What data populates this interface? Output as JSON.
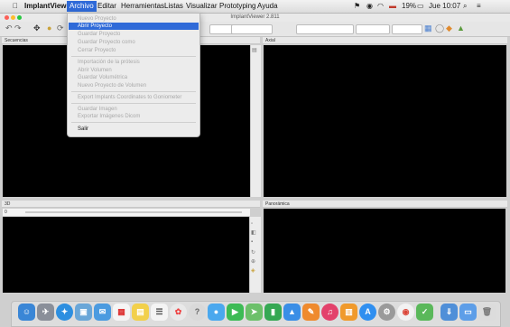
{
  "menubar": {
    "apple": "",
    "app_name": "ImplantViewer",
    "items": [
      "Archivo",
      "Editar",
      "Herramientas",
      "Listas",
      "Visualizar",
      "Prototyping",
      "Ayuda"
    ],
    "active_index": 0
  },
  "status": {
    "battery": "19%",
    "datetime": "Jue 10:07"
  },
  "window": {
    "title": "ImplantViewer 2.811"
  },
  "panels": {
    "top_left": "Secuencias",
    "top_right": "Axial",
    "bottom_left": "3D",
    "bottom_left_value": "0",
    "bottom_right": "Panorámica"
  },
  "archivo_menu": {
    "items": [
      {
        "label": "Nuevo Proyecto",
        "enabled": false
      },
      {
        "label": "Abrir Proyecto",
        "enabled": true,
        "highlighted": true
      },
      {
        "label": "Guardar Proyecto",
        "enabled": false
      },
      {
        "label": "Guardar Proyecto como",
        "enabled": false
      },
      {
        "label": "Cerrar Proyecto",
        "enabled": false
      },
      {
        "label": "Importación de la prótesis",
        "enabled": false
      },
      {
        "label": "Abrir Volumen",
        "enabled": false
      },
      {
        "label": "Guardar Volumétrica",
        "enabled": false
      },
      {
        "label": "Nuevo Proyecto de Volumen",
        "enabled": false
      },
      {
        "label": "Export Implants Coordinates to Goniometer",
        "enabled": false
      },
      {
        "label": "Guardar Imagen",
        "enabled": false
      },
      {
        "label": "Exportar Imágenes Dicom",
        "enabled": false
      },
      {
        "label": "Salir",
        "enabled": true
      }
    ]
  },
  "colors": {
    "menu_highlight": "#2f6ad8",
    "viewport": "#000000",
    "close": "#fc5f57",
    "minimize": "#fdbc2e",
    "zoom": "#28c840"
  },
  "dock": {
    "icons": [
      "finder-icon",
      "launchpad-icon",
      "safari-icon",
      "preview-icon",
      "mail-icon",
      "calendar-icon",
      "notes-icon",
      "reminders-icon",
      "photos-icon",
      "help-icon",
      "messages-icon",
      "facetime-icon",
      "maps-icon",
      "numbers-icon",
      "keynote-icon",
      "pages-icon",
      "itunes-icon",
      "ibooks-icon",
      "appstore-icon",
      "sysprefs-icon",
      "chrome-icon",
      "quicktime-icon",
      "downloads-icon",
      "folder-icon",
      "trash-icon"
    ]
  }
}
